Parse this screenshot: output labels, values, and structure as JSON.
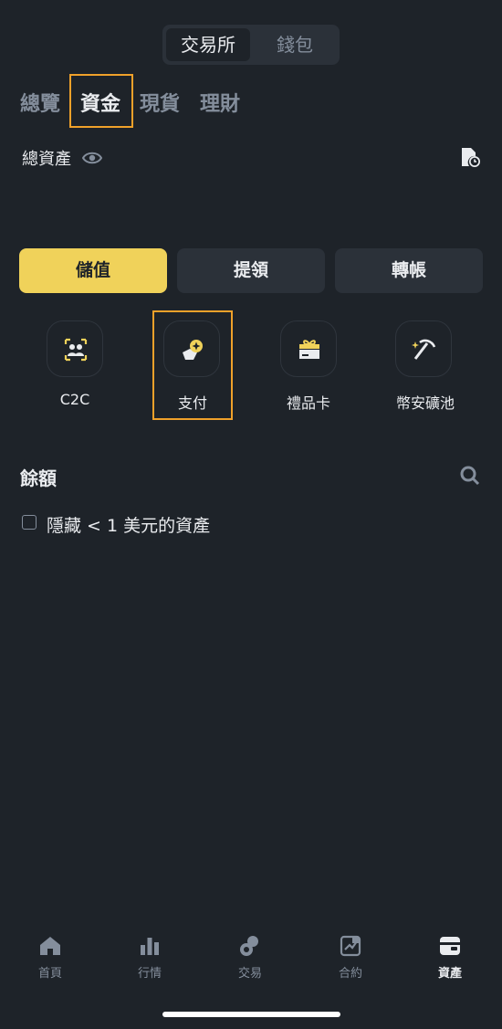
{
  "top_switch": {
    "options": [
      "交易所",
      "錢包"
    ],
    "selected": "交易所"
  },
  "tabs": [
    {
      "label": "總覽"
    },
    {
      "label": "資金"
    },
    {
      "label": "現貨"
    },
    {
      "label": "理財"
    }
  ],
  "active_tab": "資金",
  "total_assets": {
    "label": "總資產"
  },
  "actions": {
    "deposit": "儲值",
    "withdraw": "提領",
    "transfer": "轉帳"
  },
  "shortcuts": [
    {
      "label": "C2C",
      "icon": "c2c-icon"
    },
    {
      "label": "支付",
      "icon": "pay-icon"
    },
    {
      "label": "禮品卡",
      "icon": "gift-card-icon"
    },
    {
      "label": "幣安礦池",
      "icon": "pickaxe-icon"
    }
  ],
  "balance": {
    "title": "餘額",
    "hide_small_label": "隱藏 < 1 美元的資產",
    "hide_small_checked": false
  },
  "bottom_nav": [
    {
      "label": "首頁",
      "icon": "home-icon"
    },
    {
      "label": "行情",
      "icon": "markets-icon"
    },
    {
      "label": "交易",
      "icon": "trade-icon"
    },
    {
      "label": "合約",
      "icon": "futures-icon"
    },
    {
      "label": "資產",
      "icon": "wallet-icon"
    }
  ],
  "active_nav": "資產",
  "colors": {
    "background": "#1e2329",
    "accent": "#f0d25a",
    "highlight": "#f0a12a",
    "muted": "#848e9c"
  }
}
